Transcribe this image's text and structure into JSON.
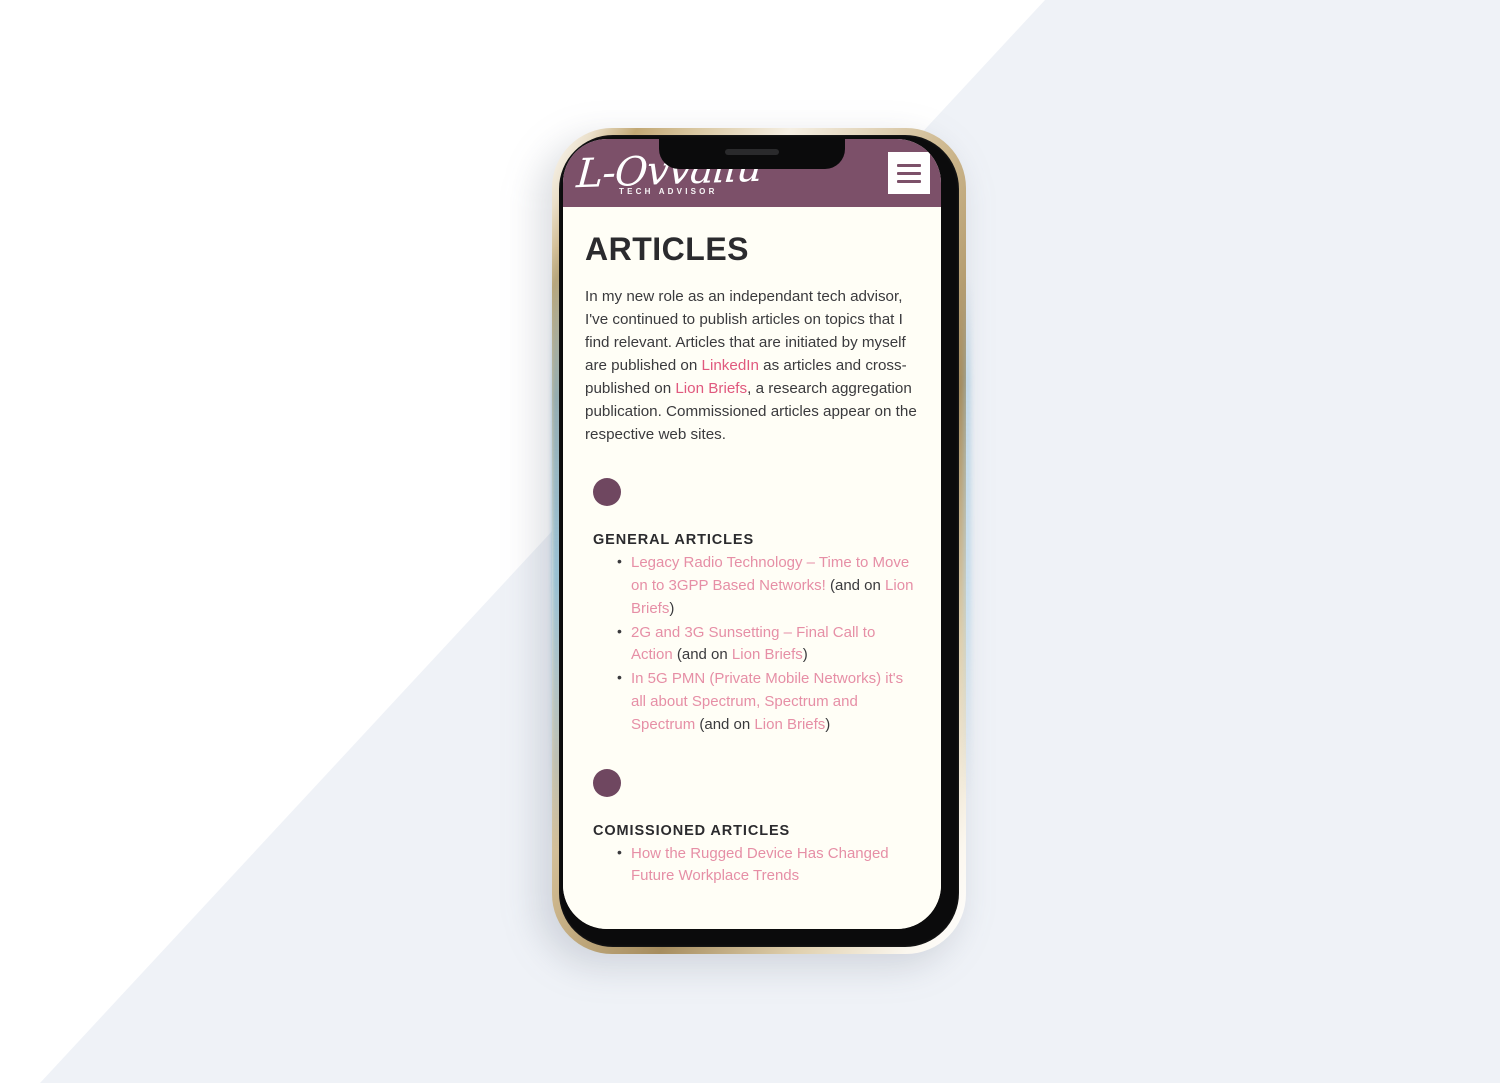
{
  "background": {
    "top_color": "#ffffff",
    "diagonal_color": "#eff2f7"
  },
  "device": {
    "frame_color": "#d3bf97",
    "bezel_color": "#0b0b0c",
    "screen_bg": "#fffef6"
  },
  "site_header": {
    "bg_color": "#7c5069",
    "brand_script": "L-Ovvallu",
    "brand_subtitle": "TECH ADVISOR",
    "menu_icon": "hamburger-icon"
  },
  "main": {
    "page_title": "ARTICLES",
    "intro": {
      "part1": "In my new role as an independant tech advisor, I've continued to publish articles on topics that I find relevant. Articles that are initiated by myself are published on ",
      "link1": "LinkedIn",
      "part2": " as articles and cross-published on ",
      "link2": "Lion Briefs",
      "part3": ", a research aggregation publication. Commissioned articles appear on the respective web sites."
    },
    "sections": [
      {
        "marker": "dot-marker",
        "heading": "GENERAL ARTICLES",
        "items": [
          {
            "title": "Legacy Radio Technology – Time to Move on to 3GPP Based Networks!",
            "suffix_open": " (and on ",
            "cross_link": "Lion Briefs",
            "suffix_close": ")"
          },
          {
            "title": "2G and 3G Sunsetting – Final Call to Action",
            "suffix_open": " (and on ",
            "cross_link": "Lion Briefs",
            "suffix_close": ")"
          },
          {
            "title": "In 5G PMN (Private Mobile Networks) it's all about Spectrum, Spectrum and Spectrum",
            "suffix_open": " (and on ",
            "cross_link": "Lion Briefs",
            "suffix_close": ")"
          }
        ]
      },
      {
        "marker": "dot-marker",
        "heading": "COMISSIONED ARTICLES",
        "items": [
          {
            "title": "How the Rugged Device Has Changed Future Workplace Trends",
            "suffix_open": "",
            "cross_link": "",
            "suffix_close": ""
          }
        ]
      }
    ]
  },
  "colors": {
    "brand_purple": "#7c5069",
    "dot_purple": "#6f4760",
    "link_pink": "#e0597e",
    "link_pink_soft": "#e68fa6",
    "body_text": "#3a3a3d",
    "heading_text": "#2b2b2e"
  }
}
